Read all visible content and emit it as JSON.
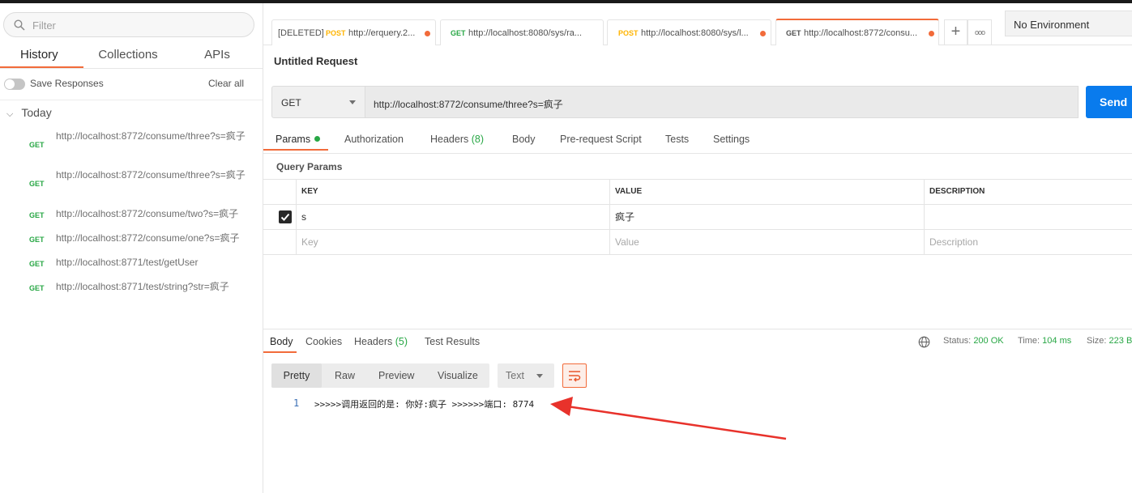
{
  "sidebar": {
    "search_placeholder": "Filter",
    "tabs": [
      "History",
      "Collections",
      "APIs"
    ],
    "save_responses": "Save Responses",
    "clear_all": "Clear all",
    "group": "Today",
    "history": [
      {
        "method": "GET",
        "url": "http://localhost:8772/consume/three?s=疯子"
      },
      {
        "method": "GET",
        "url": "http://localhost:8772/consume/three?s=疯子"
      },
      {
        "method": "GET",
        "url": "http://localhost:8772/consume/two?s=疯子"
      },
      {
        "method": "GET",
        "url": "http://localhost:8772/consume/one?s=疯子"
      },
      {
        "method": "GET",
        "url": "http://localhost:8771/test/getUser"
      },
      {
        "method": "GET",
        "url": "http://localhost:8771/test/string?str=疯子"
      }
    ]
  },
  "request_tabs": [
    {
      "prefix": "[DELETED]",
      "method": "POST",
      "title": "http://erquery.2..."
    },
    {
      "prefix": "",
      "method": "GET",
      "title": "http://localhost:8080/sys/ra..."
    },
    {
      "prefix": "",
      "method": "POST",
      "title": "http://localhost:8080/sys/l..."
    },
    {
      "prefix": "",
      "method": "GET",
      "title": "http://localhost:8772/consu..."
    }
  ],
  "add_tab": "+",
  "more_tabs": "ooo",
  "environment": "No Environment",
  "request": {
    "title": "Untitled Request",
    "method": "GET",
    "url": "http://localhost:8772/consume/three?s=疯子",
    "send": "Send"
  },
  "req_tabs": {
    "params": "Params",
    "authorization": "Authorization",
    "headers": "Headers",
    "headers_count": "(8)",
    "body": "Body",
    "pre_request": "Pre-request Script",
    "tests": "Tests",
    "settings": "Settings"
  },
  "query_params": {
    "title": "Query Params",
    "columns": [
      "KEY",
      "VALUE",
      "DESCRIPTION"
    ],
    "rows": [
      {
        "key": "s",
        "value": "疯子",
        "description": ""
      }
    ],
    "placeholders": {
      "key": "Key",
      "value": "Value",
      "description": "Description"
    }
  },
  "response": {
    "tabs": {
      "body": "Body",
      "cookies": "Cookies",
      "headers": "Headers",
      "headers_count": "(5)",
      "test_results": "Test Results"
    },
    "status_label": "Status:",
    "status_value": "200 OK",
    "time_label": "Time:",
    "time_value": "104 ms",
    "size_label": "Size:",
    "size_value": "223 B",
    "formats": [
      "Pretty",
      "Raw",
      "Preview",
      "Visualize"
    ],
    "type": "Text",
    "line_number": "1",
    "body_text": ">>>>>调用返回的是: 你好:疯子 >>>>>>端口: 8774"
  },
  "colors": {
    "accent": "#f26b3a",
    "get": "#28a745",
    "post": "#ffb400",
    "send": "#097bed",
    "annotation_arrow": "#e8322b"
  }
}
